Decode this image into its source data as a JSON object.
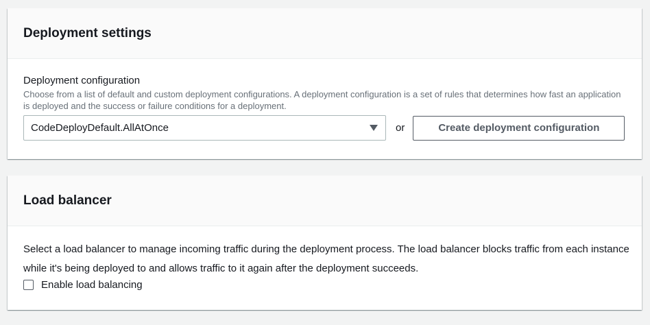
{
  "deployment_settings": {
    "title": "Deployment settings",
    "config_label": "Deployment configuration",
    "config_description": "Choose from a list of default and custom deployment configurations. A deployment configuration is a set of rules that determines how fast an application is deployed and the success or failure conditions for a deployment.",
    "select_value": "CodeDeployDefault.AllAtOnce",
    "select_icon": "caret-down-icon",
    "or_text": "or",
    "create_button_label": "Create deployment configuration"
  },
  "load_balancer": {
    "title": "Load balancer",
    "description": "Select a load balancer to manage incoming traffic during the deployment process. The load balancer blocks traffic from each instance while it's being deployed to and allows traffic to it again after the deployment succeeds.",
    "checkbox_label": "Enable load balancing",
    "checkbox_checked": false
  }
}
